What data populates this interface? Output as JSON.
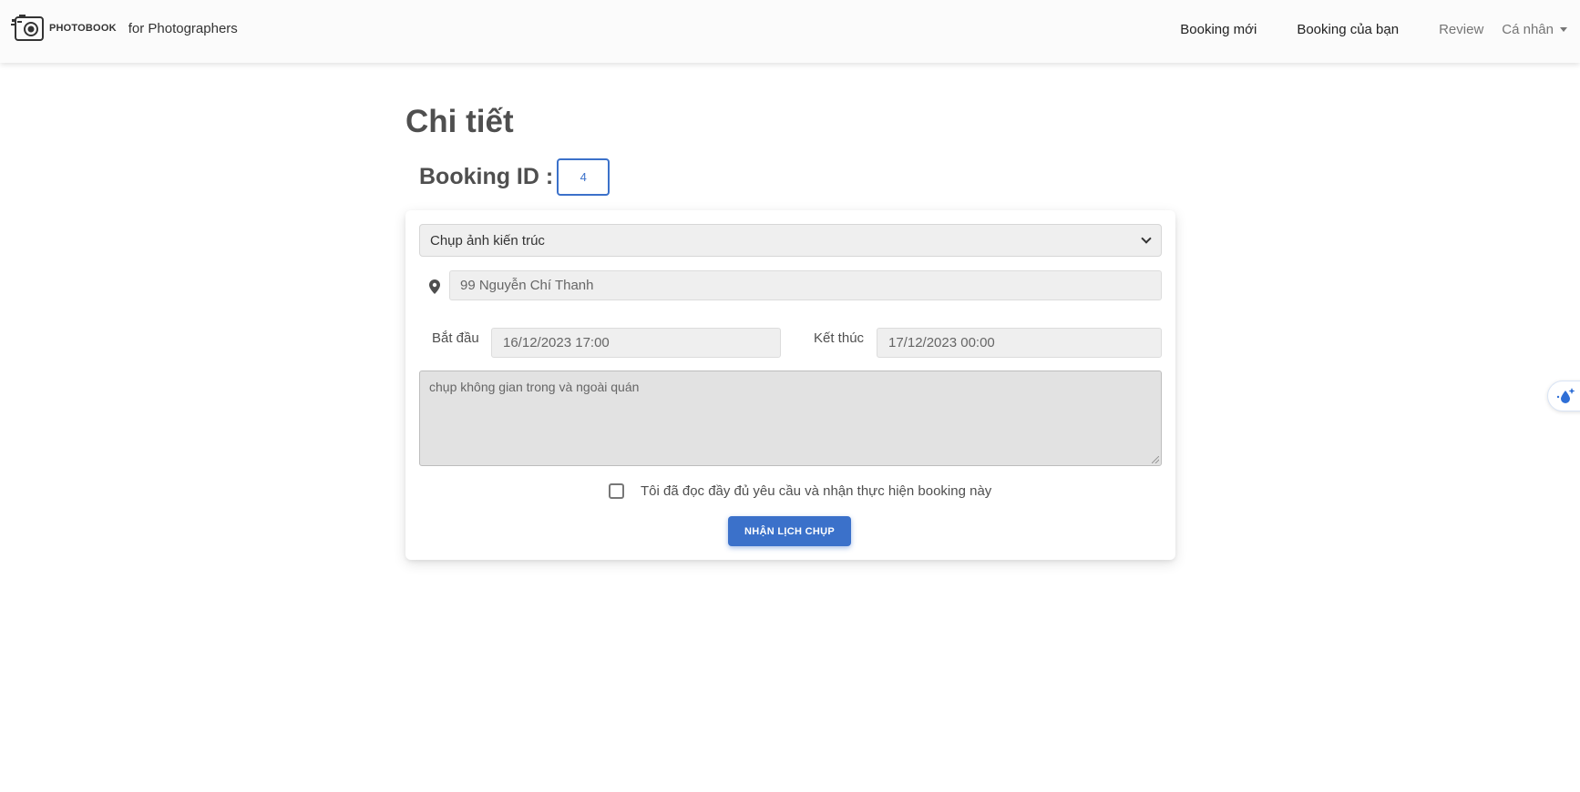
{
  "navbar": {
    "logo_text": "PHOTOBOOK",
    "brand_subtitle": "for Photographers",
    "links": [
      {
        "label": "Booking mới"
      },
      {
        "label": "Booking của bạn"
      },
      {
        "label": "Review"
      },
      {
        "label": "Cá nhân"
      }
    ]
  },
  "page": {
    "title": "Chi tiết",
    "booking_id_label": "Booking ID :",
    "booking_id_value": "4"
  },
  "form": {
    "service_type": "Chụp ảnh kiến trúc",
    "address": "99 Nguyễn Chí Thanh",
    "start_label": "Bắt đầu",
    "start_value": "16/12/2023 17:00",
    "end_label": "Kết thúc",
    "end_value": "17/12/2023 00:00",
    "note": "chụp không gian trong và ngoài quán",
    "agree_text": "Tôi đã đọc đầy đủ yêu cầu và nhận thực hiện booking này",
    "agree_checked": false,
    "submit_label": "Nhận lịch chụp"
  },
  "icons": {
    "logo": "camera-icon",
    "address": "map-pin-icon",
    "select": "chevron-down-icon",
    "widget": "water-drop-sparkle-icon"
  },
  "colors": {
    "primary": "#3b71ca",
    "navbar_bg": "#fbfbfb",
    "field_bg": "#efefef",
    "note_bg": "#e2e2e2"
  }
}
